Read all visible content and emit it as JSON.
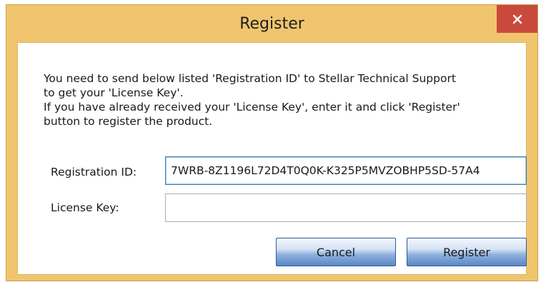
{
  "window": {
    "title": "Register",
    "close_glyph": "✕",
    "close_icon": "close-icon"
  },
  "message": {
    "line1": "You need to send below listed 'Registration ID' to Stellar Technical Support",
    "line2": "to get your 'License Key'.",
    "line3": "If you have already received your 'License Key', enter it and click 'Register'",
    "line4": "button to register the product."
  },
  "registration_id": {
    "label": "Registration ID:",
    "value": "7WRB-8Z1196L72D4T0Q0K-K325P5MVZOBHP5SD-57A4"
  },
  "license_key": {
    "label": "License Key:",
    "value": ""
  },
  "buttons": {
    "cancel_label": "Cancel",
    "register_label": "Register"
  },
  "colors": {
    "titlebar": "#f0c56e",
    "close_button": "#c94a3c",
    "button_border": "#2d5a93"
  }
}
